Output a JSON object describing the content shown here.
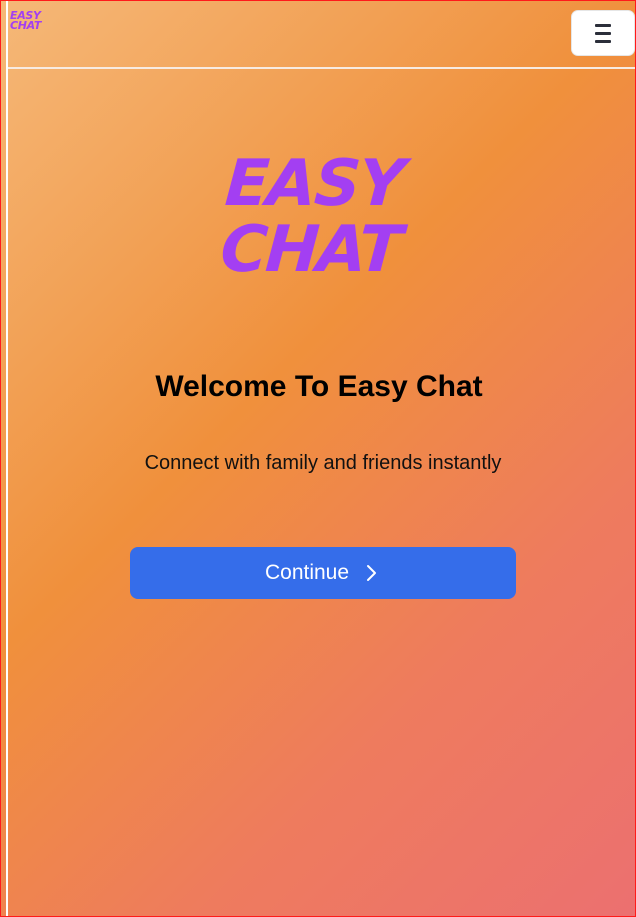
{
  "header": {
    "logo_line1": "EASY",
    "logo_line2": "CHAT",
    "menu_icon": "hamburger-menu-icon"
  },
  "hero": {
    "logo_line1": "EASY",
    "logo_line2": "CHAT",
    "welcome_prefix": "Welcome To",
    "welcome_brand": "Easy Chat",
    "subtitle": "Connect with family and friends instantly"
  },
  "actions": {
    "continue_label": "Continue",
    "continue_icon": "chevron-right-icon"
  },
  "colors": {
    "brand_purple": "#a33ff2",
    "button_blue": "#356dea",
    "gradient_start": "#f5b878",
    "gradient_mid": "#f0903c",
    "gradient_end": "#ec7070"
  }
}
